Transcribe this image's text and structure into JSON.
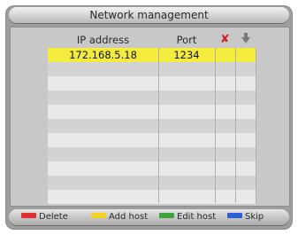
{
  "title": "Network management",
  "table": {
    "headers": {
      "ip": "IP address",
      "port": "Port",
      "delete_icon": "close-x-icon",
      "move_icon": "arrow-down-icon"
    },
    "rows": [
      {
        "ip": "172.168.5.18",
        "port": "1234",
        "selected": true
      },
      {
        "ip": "",
        "port": ""
      },
      {
        "ip": "",
        "port": ""
      },
      {
        "ip": "",
        "port": ""
      },
      {
        "ip": "",
        "port": ""
      },
      {
        "ip": "",
        "port": ""
      },
      {
        "ip": "",
        "port": ""
      },
      {
        "ip": "",
        "port": ""
      },
      {
        "ip": "",
        "port": ""
      },
      {
        "ip": "",
        "port": ""
      },
      {
        "ip": "",
        "port": ""
      }
    ]
  },
  "keys": [
    {
      "label": "Delete",
      "color": "#e03131"
    },
    {
      "label": "Add host",
      "color": "#f2d21c"
    },
    {
      "label": "Edit host",
      "color": "#3da33d"
    },
    {
      "label": "Skip",
      "color": "#2f5fd8"
    }
  ],
  "colors": {
    "selected_row": "#f4ec3c",
    "panel": "#c8c8c8",
    "delete_x": "#d02020"
  }
}
